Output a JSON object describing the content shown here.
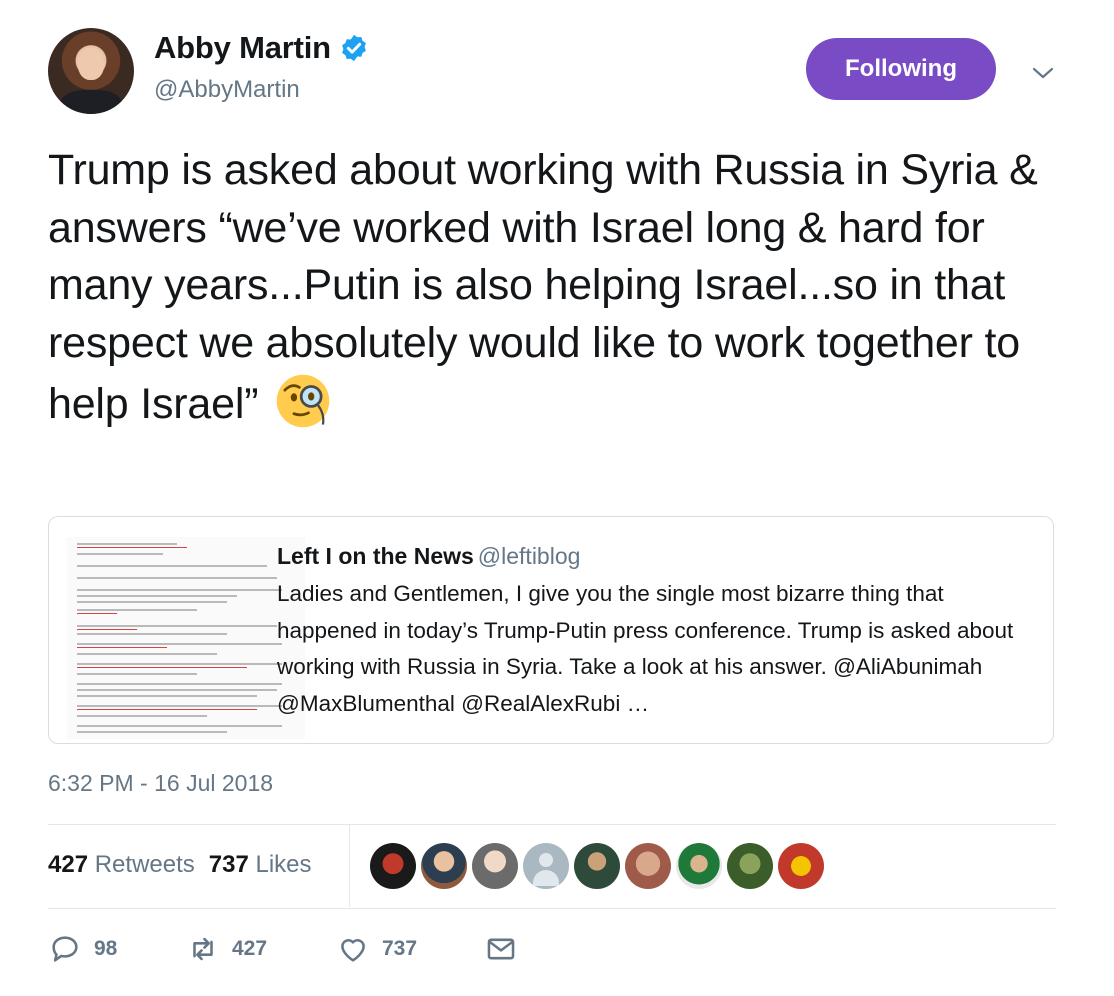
{
  "author": {
    "display_name": "Abby Martin",
    "handle": "@AbbyMartin",
    "verified": true
  },
  "follow_button": {
    "label": "Following",
    "color": "#794bc4"
  },
  "tweet": {
    "text": "Trump is asked about working with Russia in Syria & answers “we’ve worked with Israel long & hard for many years...Putin is also helping Israel...so in that respect we absolutely would like to work together to help Israel”",
    "emoji": "face-with-monocle"
  },
  "quote": {
    "author": "Left I on the News",
    "handle": "@leftiblog",
    "text": "Ladies and Gentlemen, I give you the single most bizarre thing that happened in today’s Trump-Putin press conference. Trump is asked about working with Russia in Syria. Take a look at his answer. @AliAbunimah @MaxBlumenthal @RealAlexRubi …"
  },
  "timestamp": "6:32 PM - 16 Jul 2018",
  "stats": {
    "retweets_count": "427",
    "retweets_label": "Retweets",
    "likes_count": "737",
    "likes_label": "Likes"
  },
  "actions": {
    "replies": "98",
    "retweets": "427",
    "likes": "737"
  },
  "colors": {
    "accent": "#794bc4",
    "muted_text": "#657786",
    "verified": "#1da1f2",
    "border": "#e1e8ed"
  }
}
